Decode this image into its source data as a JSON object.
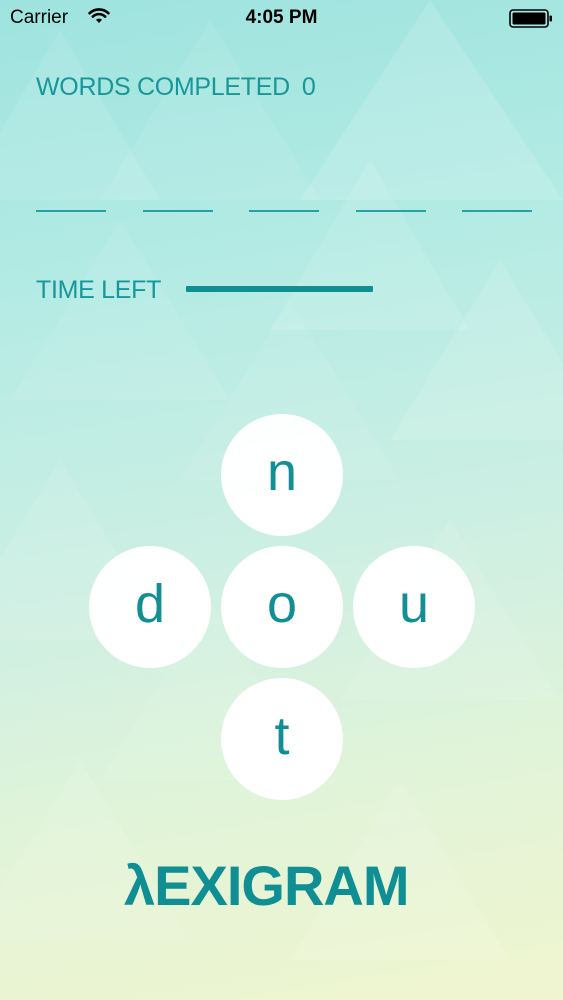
{
  "status_bar": {
    "carrier": "Carrier",
    "time": "4:05 PM",
    "wifi_icon": "wifi-icon",
    "battery_icon": "battery-icon"
  },
  "game": {
    "words_completed_label": "WORDS COMPLETED",
    "words_completed_count": "0",
    "blank_count": 5,
    "time_left_label": "TIME LEFT",
    "time_left_fraction": 1.0,
    "letters": {
      "top": "n",
      "left": "d",
      "center": "o",
      "right": "u",
      "bottom": "t"
    }
  },
  "logo": {
    "text": "λEXIGRAM"
  },
  "colors": {
    "accent": "#0f8e93",
    "text": "#17979a",
    "tile": "#ffffff"
  }
}
